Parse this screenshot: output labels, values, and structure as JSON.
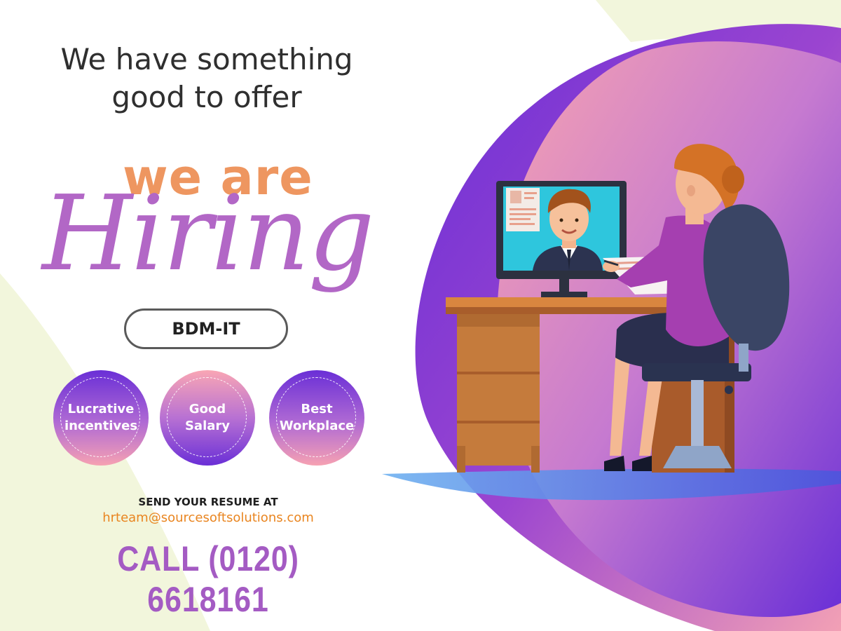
{
  "headline": {
    "line1": "We have something",
    "line2": "good to offer"
  },
  "title": {
    "we_are": "we are",
    "hiring": "Hiring"
  },
  "position": "BDM-IT",
  "perks": [
    {
      "label": "Lucrative\nincentives"
    },
    {
      "label": "Good\nSalary"
    },
    {
      "label": "Best\nWorkplace"
    }
  ],
  "contact": {
    "send_label": "SEND YOUR RESUME AT",
    "email": "hrteam@sourcesoftsolutions.com",
    "phone": "CALL (0120) 6618161"
  },
  "colors": {
    "accent_orange": "#ee9660",
    "accent_purple": "#a45bc3",
    "blob_purple": "#6a2fd6",
    "blob_pink": "#f6a1b2",
    "background_cream": "#f2f6dc"
  },
  "illustration": {
    "subject": "woman at desk on video call with man on monitor"
  }
}
